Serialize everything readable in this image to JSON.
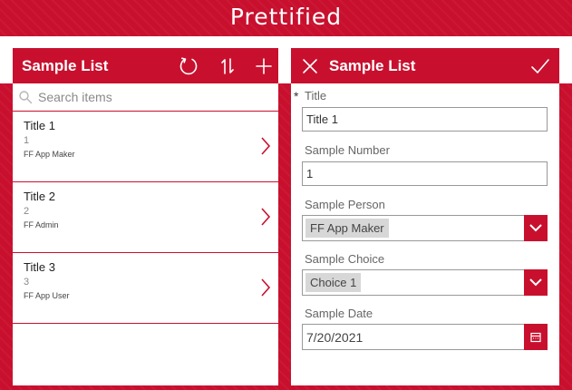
{
  "app": {
    "title": "Prettified"
  },
  "list_panel": {
    "title": "Sample List",
    "icons": {
      "refresh": "refresh-icon",
      "sort": "sort-icon",
      "add": "add-icon"
    },
    "search": {
      "placeholder": "Search items",
      "value": ""
    },
    "items": [
      {
        "title": "Title 1",
        "number": "1",
        "person": "FF App Maker"
      },
      {
        "title": "Title 2",
        "number": "2",
        "person": "FF Admin"
      },
      {
        "title": "Title 3",
        "number": "3",
        "person": "FF App User"
      }
    ]
  },
  "form_panel": {
    "title": "Sample List",
    "icons": {
      "close": "close-icon",
      "submit": "checkmark-icon"
    },
    "fields": {
      "title": {
        "label": "Title",
        "value": "Title 1",
        "required_marker": "*"
      },
      "number": {
        "label": "Sample Number",
        "value": "1"
      },
      "person": {
        "label": "Sample Person",
        "value": "FF App Maker"
      },
      "choice": {
        "label": "Sample Choice",
        "value": "Choice 1"
      },
      "date": {
        "label": "Sample Date",
        "value": "7/20/2021"
      }
    }
  },
  "colors": {
    "accent": "#c8102e",
    "panel": "#ffffff",
    "muted_text": "#8a8a8a"
  }
}
